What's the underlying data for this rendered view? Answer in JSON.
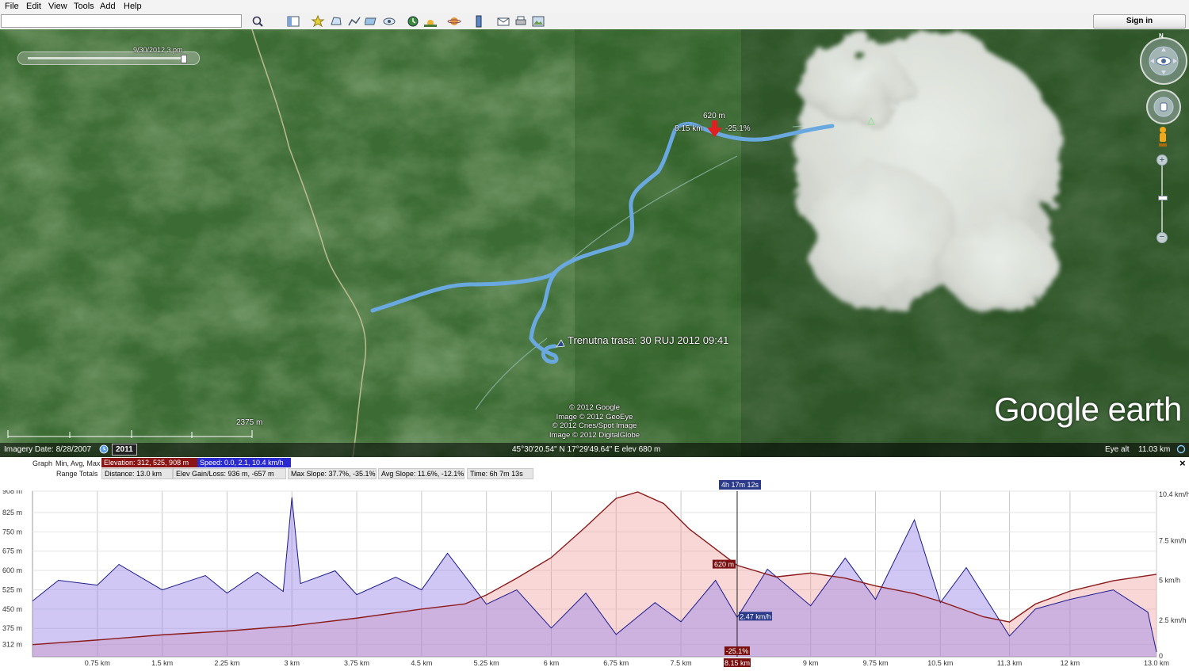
{
  "menu": [
    "File",
    "Edit",
    "View",
    "Tools",
    "Add",
    "Help"
  ],
  "toolbar": {
    "sign_in": "Sign in",
    "search_value": ""
  },
  "toolbar_icons": [
    "search-icon",
    "sidebar-icon",
    "placemark-icon",
    "polygon-icon",
    "path-icon",
    "overlay-icon",
    "tour-icon",
    "historical-imagery-icon",
    "sun-icon",
    "planets-icon",
    "ruler-icon",
    "email-icon",
    "print-icon",
    "save-image-icon"
  ],
  "map": {
    "time_slider_label": "9/30/2012  3 pm",
    "marker_elev": "620 m",
    "marker_dist": "8.15 km",
    "marker_slope": "-25.1%",
    "track_label": "Trenutna trasa: 30 RUJ 2012 09:41",
    "scale_label": "2375 m",
    "copyright": [
      "© 2012 Google",
      "Image © 2012 GeoEye",
      "© 2012 Cnes/Spot Image",
      "Image © 2012 DigitalGlobe"
    ],
    "logo_text": "Google earth",
    "compass_n": "N"
  },
  "status": {
    "imagery_date": "Imagery Date: 8/28/2007",
    "year": "2011",
    "coords": "45°30'20.54\" N  17°29'49.64\" E  elev   680 m",
    "eye_alt_label": "Eye alt",
    "eye_alt_value": "11.03 km"
  },
  "graph_header": {
    "graph_label": "Graph",
    "min_avg_max_label": "Min, Avg, Max",
    "elevation": "Elevation: 312, 525, 908 m",
    "speed": "Speed: 0.0, 2.1, 10.4 km/h",
    "range_totals_label": "Range Totals",
    "distance": "Distance: 13.0 km",
    "elev_gain_loss": "Elev Gain/Loss: 936 m, -657 m",
    "max_slope": "Max Slope: 37.7%, -35.1%",
    "avg_slope": "Avg Slope: 11.6%, -12.1%",
    "time": "Time: 6h 7m 13s",
    "close": "×"
  },
  "chart_data": {
    "type": "area",
    "x_unit": "km",
    "xlim": [
      0,
      13.0
    ],
    "x_ticks": [
      "0.75 km",
      "1.5 km",
      "2.25 km",
      "3 km",
      "3.75 km",
      "4.5 km",
      "5.25 km",
      "6 km",
      "6.75 km",
      "7.5 km",
      "8.15 km",
      "9 km",
      "9.75 km",
      "10.5 km",
      "11.3 km",
      "12 km",
      "13.0 km"
    ],
    "x_tick_values": [
      0.75,
      1.5,
      2.25,
      3,
      3.75,
      4.5,
      5.25,
      6,
      6.75,
      7.5,
      8.15,
      9,
      9.75,
      10.5,
      11.3,
      12,
      13.0
    ],
    "left_axis": {
      "label_unit": "m",
      "ticks": [
        "908 m",
        "825 m",
        "750 m",
        "675 m",
        "600 m",
        "525 m",
        "450 m",
        "375 m",
        "312 m"
      ],
      "tick_values": [
        908,
        825,
        750,
        675,
        600,
        525,
        450,
        375,
        312
      ],
      "ylim": [
        265,
        908
      ]
    },
    "right_axis": {
      "label_unit": "km/h",
      "ticks": [
        "10.4 km/h",
        "7.5 km/h",
        "5 km/h",
        "2.5 km/h",
        "0"
      ],
      "tick_values": [
        10.4,
        7.5,
        5,
        2.5,
        0
      ],
      "ylim": [
        0,
        10.4
      ]
    },
    "series": [
      {
        "name": "Elevation",
        "color": "#8b1a1a",
        "x": [
          0,
          0.75,
          1.5,
          2.25,
          3,
          3.75,
          4.5,
          5.0,
          5.25,
          5.6,
          6,
          6.4,
          6.75,
          7.0,
          7.3,
          7.6,
          8.15,
          8.6,
          9.0,
          9.4,
          9.75,
          10.2,
          10.5,
          11.0,
          11.3,
          11.6,
          12,
          12.5,
          13.0
        ],
        "y": [
          312,
          330,
          350,
          365,
          385,
          415,
          450,
          470,
          505,
          570,
          650,
          770,
          880,
          905,
          860,
          760,
          620,
          575,
          590,
          570,
          540,
          510,
          480,
          420,
          400,
          470,
          520,
          560,
          585
        ]
      },
      {
        "name": "Speed",
        "color": "#1a1a8b",
        "x": [
          0,
          0.3,
          0.75,
          1.0,
          1.5,
          2.0,
          2.25,
          2.6,
          2.9,
          3.0,
          3.1,
          3.5,
          3.75,
          4.2,
          4.5,
          4.8,
          5.25,
          5.6,
          6,
          6.4,
          6.75,
          7.2,
          7.5,
          7.9,
          8.15,
          8.5,
          9,
          9.4,
          9.75,
          10.2,
          10.5,
          10.8,
          11.3,
          11.6,
          12,
          12.5,
          12.9,
          13.0
        ],
        "y": [
          3.5,
          4.8,
          4.5,
          5.8,
          4.2,
          5.1,
          4.0,
          5.3,
          4.1,
          10.0,
          4.6,
          5.4,
          3.9,
          5.0,
          4.2,
          6.5,
          3.3,
          4.2,
          1.8,
          4.0,
          1.4,
          3.4,
          2.2,
          4.8,
          2.47,
          5.5,
          3.2,
          6.2,
          3.6,
          8.6,
          3.4,
          5.6,
          1.3,
          3.0,
          3.6,
          4.2,
          2.8,
          0.3
        ]
      }
    ],
    "cursor": {
      "x": 8.15,
      "time_label": "4h 17m 12s",
      "elev_label": "620 m",
      "speed_label": "2.47 km/h",
      "slope_label": "-25.1%",
      "x_label": "8.15 km"
    },
    "grid": true
  }
}
